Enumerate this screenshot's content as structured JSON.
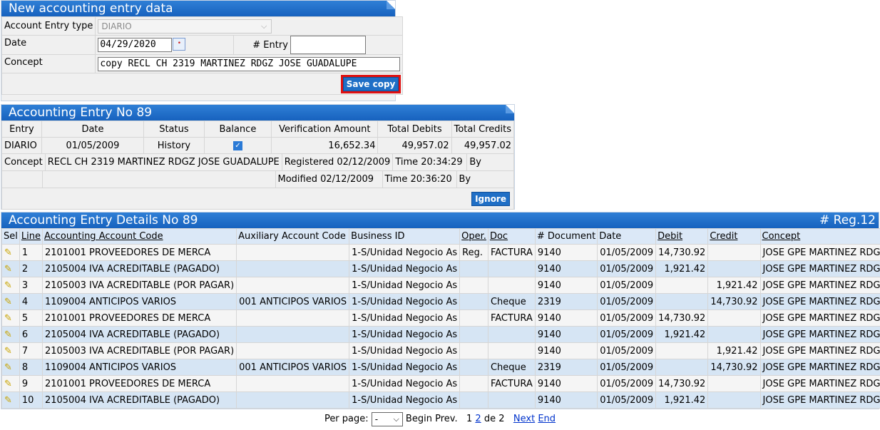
{
  "new_entry": {
    "title": "New accounting entry data",
    "type_label": "Account Entry type",
    "type_value": "DIARIO",
    "date_label": "Date",
    "date_value": "04/29/2020",
    "entry_label": "# Entry",
    "entry_value": "",
    "concept_label": "Concept",
    "concept_value": "copy RECL CH 2319 MARTINEZ RDGZ JOSE GUADALUPE",
    "save_label": "Save copy"
  },
  "entry": {
    "title": "Accounting Entry No 89",
    "headers": [
      "Entry",
      "Date",
      "Status",
      "Balance",
      "Verification Amount",
      "Total Debits",
      "Total Credits"
    ],
    "entry": "DIARIO",
    "date": "01/05/2009",
    "status": "History",
    "verification_amount": "16,652.34",
    "total_debits": "49,957.02",
    "total_credits": "49,957.02",
    "concept_label": "Concept",
    "concept": "RECL CH 2319 MARTINEZ RDGZ JOSE GUADALUPE",
    "registered": "Registered 02/12/2009",
    "registered_time": "Time  20:34:29",
    "modified": "Modified 02/12/2009",
    "modified_time": "Time  20:36:20",
    "by_label": "By",
    "ignore_label": "Ignore"
  },
  "details": {
    "title": "Accounting Entry Details No 89",
    "reg_count": "# Reg.12",
    "headers": [
      "Sel",
      "Line",
      "Accounting Account Code",
      "Auxiliary Account Code",
      "Business ID",
      "Oper.",
      "Doc",
      "# Document",
      "Date",
      "Debit",
      "Credit",
      "Concept"
    ],
    "rows": [
      {
        "line": "1",
        "account": "2101001 PROVEEDORES DE MERCA",
        "aux": "",
        "business": "1-S/Unidad Negocio As",
        "oper": "Reg.",
        "doc": "FACTURA",
        "document": "9140",
        "date": "01/05/2009",
        "debit": "14,730.92",
        "credit": "",
        "concept": "JOSE GPE MARTINEZ RDGZ"
      },
      {
        "line": "2",
        "account": "2105004 IVA ACREDITABLE (PAGADO)",
        "aux": "",
        "business": "1-S/Unidad Negocio As",
        "oper": "",
        "doc": "",
        "document": "9140",
        "date": "01/05/2009",
        "debit": "1,921.42",
        "credit": "",
        "concept": "JOSE GPE MARTINEZ RDGZ"
      },
      {
        "line": "3",
        "account": "2105003 IVA ACREDITABLE (POR PAGAR)",
        "aux": "",
        "business": "1-S/Unidad Negocio As",
        "oper": "",
        "doc": "",
        "document": "9140",
        "date": "01/05/2009",
        "debit": "",
        "credit": "1,921.42",
        "concept": "JOSE GPE MARTINEZ RDGZ"
      },
      {
        "line": "4",
        "account": "1109004 ANTICIPOS VARIOS",
        "aux": "001 ANTICIPOS VARIOS",
        "business": "1-S/Unidad Negocio As",
        "oper": "",
        "doc": "Cheque",
        "document": "2319",
        "date": "01/05/2009",
        "debit": "",
        "credit": "14,730.92",
        "concept": "JOSE GPE MARTINEZ RDGZ"
      },
      {
        "line": "5",
        "account": "2101001 PROVEEDORES DE MERCA",
        "aux": "",
        "business": "1-S/Unidad Negocio As",
        "oper": "",
        "doc": "FACTURA",
        "document": "9140",
        "date": "01/05/2009",
        "debit": "14,730.92",
        "credit": "",
        "concept": "JOSE GPE MARTINEZ RDGZ"
      },
      {
        "line": "6",
        "account": "2105004 IVA ACREDITABLE (PAGADO)",
        "aux": "",
        "business": "1-S/Unidad Negocio As",
        "oper": "",
        "doc": "",
        "document": "9140",
        "date": "01/05/2009",
        "debit": "1,921.42",
        "credit": "",
        "concept": "JOSE GPE MARTINEZ RDGZ"
      },
      {
        "line": "7",
        "account": "2105003 IVA ACREDITABLE (POR PAGAR)",
        "aux": "",
        "business": "1-S/Unidad Negocio As",
        "oper": "",
        "doc": "",
        "document": "9140",
        "date": "01/05/2009",
        "debit": "",
        "credit": "1,921.42",
        "concept": "JOSE GPE MARTINEZ RDGZ"
      },
      {
        "line": "8",
        "account": "1109004 ANTICIPOS VARIOS",
        "aux": "001 ANTICIPOS VARIOS",
        "business": "1-S/Unidad Negocio As",
        "oper": "",
        "doc": "Cheque",
        "document": "2319",
        "date": "01/05/2009",
        "debit": "",
        "credit": "14,730.92",
        "concept": "JOSE GPE MARTINEZ RDGZ"
      },
      {
        "line": "9",
        "account": "2101001 PROVEEDORES DE MERCA",
        "aux": "",
        "business": "1-S/Unidad Negocio As",
        "oper": "",
        "doc": "FACTURA",
        "document": "9140",
        "date": "01/05/2009",
        "debit": "14,730.92",
        "credit": "",
        "concept": "JOSE GPE MARTINEZ RDGZ"
      },
      {
        "line": "10",
        "account": "2105004 IVA ACREDITABLE (PAGADO)",
        "aux": "",
        "business": "1-S/Unidad Negocio As",
        "oper": "",
        "doc": "",
        "document": "9140",
        "date": "01/05/2009",
        "debit": "1,921.42",
        "credit": "",
        "concept": "JOSE GPE MARTINEZ RDGZ"
      }
    ]
  },
  "pager": {
    "per_page_label": "Per page:",
    "per_page_value": "-",
    "begin_label": "Begin",
    "prev_label": "Prev.",
    "page_1": "1",
    "page_2": "2",
    "of_label": "de 2",
    "next_label": "Next",
    "end_label": "End"
  }
}
